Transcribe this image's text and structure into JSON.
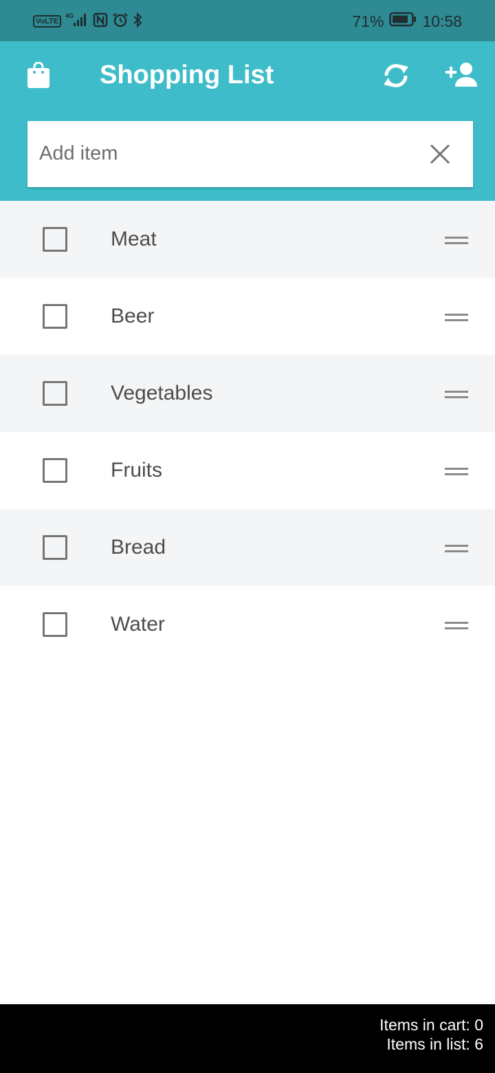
{
  "status_bar": {
    "network_badge": "VoLTE",
    "network_type": "4G",
    "battery": "71%",
    "time": "10:58",
    "icons": [
      "signal-icon",
      "nfc-icon",
      "alarm-icon",
      "bluetooth-icon",
      "battery-icon"
    ]
  },
  "app_bar": {
    "title": "Shopping List",
    "icons": [
      "shopping-bag-icon",
      "sync-icon",
      "add-person-icon"
    ],
    "background_color": "#3ebcc9"
  },
  "search": {
    "placeholder": "Add item",
    "value": ""
  },
  "items": [
    {
      "label": "Meat",
      "checked": false
    },
    {
      "label": "Beer",
      "checked": false
    },
    {
      "label": "Vegetables",
      "checked": false
    },
    {
      "label": "Fruits",
      "checked": false
    },
    {
      "label": "Bread",
      "checked": false
    },
    {
      "label": "Water",
      "checked": false
    }
  ],
  "footer": {
    "cart_text": "Items in cart: 0",
    "list_text": "Items in list: 6"
  }
}
